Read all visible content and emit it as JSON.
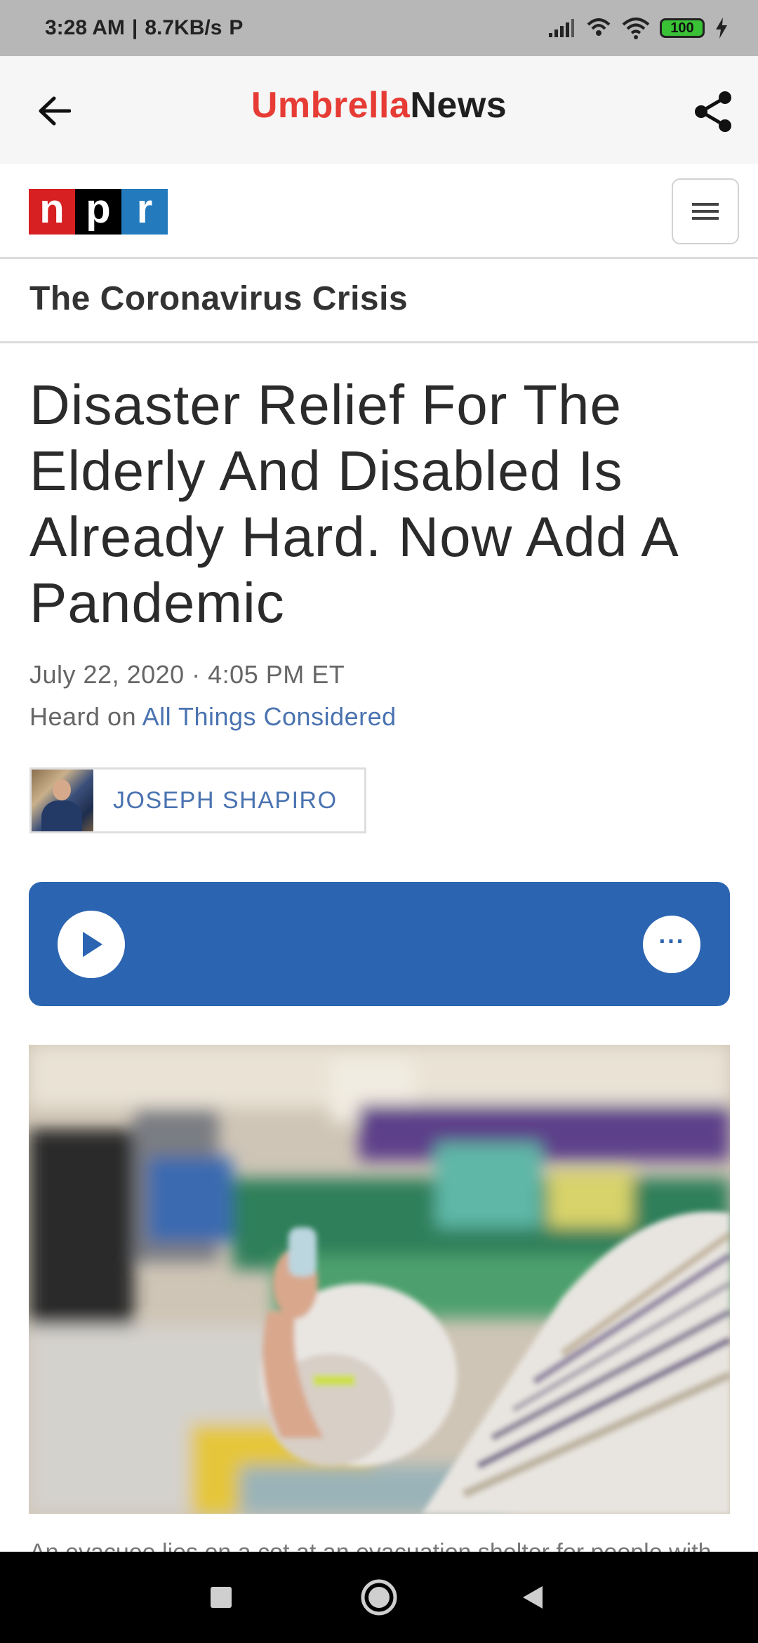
{
  "status_bar": {
    "time": "3:28 AM",
    "separator": "|",
    "speed": "8.7KB/s",
    "carrier_icon_letter": "P",
    "battery": "100"
  },
  "app_bar": {
    "brand_part1": "Umbrella",
    "brand_part2": "News",
    "brand_color": "#e63c35"
  },
  "site": {
    "logo_letters": [
      "n",
      "p",
      "r"
    ],
    "section_title": "The Coronavirus Crisis"
  },
  "article": {
    "headline": "Disaster Relief For The Elderly And Disabled Is Already Hard. Now Add A Pandemic",
    "date": "July 22, 2020 · 4:05 PM ET",
    "heard_on_prefix": "Heard on",
    "program": "All Things Considered",
    "author": "JOSEPH SHAPIRO",
    "caption": "An evacuee lies on a cot at an evacuation shelter for people with"
  },
  "player": {
    "accent": "#2b64b0",
    "more_label": "···"
  },
  "colors": {
    "link": "#4a73b0",
    "npr_red": "#d62021",
    "npr_black": "#000000",
    "npr_blue": "#237bbd"
  }
}
